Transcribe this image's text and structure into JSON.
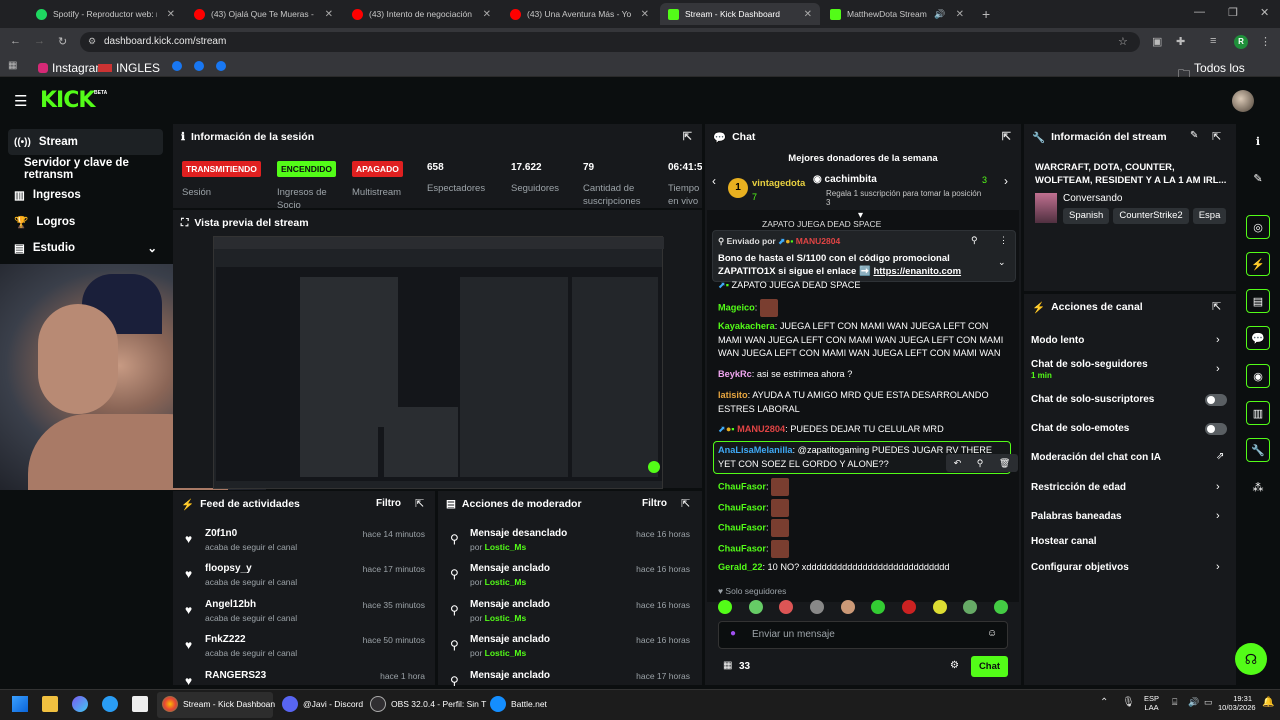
{
  "browser": {
    "tabs": [
      {
        "title": "Spotify - Reproductor web: mús",
        "color": "#1ed760"
      },
      {
        "title": "(43) Ojalá Que Te Mueras - You",
        "color": "#ff0000"
      },
      {
        "title": "(43) Intento de negociación en",
        "color": "#ff0000"
      },
      {
        "title": "(43) Una Aventura Más - YouTu",
        "color": "#ff0000"
      },
      {
        "title": "Stream - Kick Dashboard",
        "color": "#53fc18"
      },
      {
        "title": "MatthewDota Stream - Wa",
        "color": "#53fc18"
      }
    ],
    "url": "dashboard.kick.com/stream",
    "bookmarks": [
      "Instagram",
      "INGLES"
    ],
    "all_bookmarks": "Todos los marcadores",
    "profile_initial": "R"
  },
  "kick": {
    "logo": "KICK",
    "beta": "BETA",
    "sidebar": [
      {
        "label": "Stream",
        "icon": "stream-icon"
      },
      {
        "label": "Servidor y clave de retransm",
        "icon": ""
      },
      {
        "label": "Ingresos",
        "icon": "revenue-icon"
      },
      {
        "label": "Logros",
        "icon": "trophy-icon"
      },
      {
        "label": "Estudio",
        "icon": "studio-icon"
      }
    ],
    "session": {
      "title": "Información de la sesión",
      "badges": [
        {
          "text": "TRANSMITIENDO",
          "label": "Sesión"
        },
        {
          "text": "ENCENDIDO",
          "label": "Ingresos de Socio"
        },
        {
          "text": "APAGADO",
          "label": "Multistream"
        }
      ],
      "stats": [
        {
          "value": "658",
          "label": "Espectadores"
        },
        {
          "value": "17.622",
          "label": "Seguidores"
        },
        {
          "value": "79",
          "label": "Cantidad de suscripciones"
        },
        {
          "value": "06:41:5",
          "label": "Tiempo en vivo"
        }
      ]
    },
    "preview": {
      "title": "Vista previa del stream"
    },
    "feed": {
      "title": "Feed de actividades",
      "filter": "Filtro",
      "items": [
        {
          "name": "Z0f1n0",
          "sub": "acaba de seguir el canal",
          "time": "hace 14 minutos"
        },
        {
          "name": "floopsy_y",
          "sub": "acaba de seguir el canal",
          "time": "hace 17 minutos"
        },
        {
          "name": "Angel12bh",
          "sub": "acaba de seguir el canal",
          "time": "hace 35 minutos"
        },
        {
          "name": "FnkZ222",
          "sub": "acaba de seguir el canal",
          "time": "hace 50 minutos"
        },
        {
          "name": "RANGERS23",
          "sub": "",
          "time": "hace 1 hora"
        }
      ]
    },
    "modactions": {
      "title": "Acciones de moderador",
      "filter": "Filtro",
      "items": [
        {
          "action": "Mensaje desanclado",
          "by": "por",
          "user": "Lostic_Ms",
          "time": "hace 16 horas"
        },
        {
          "action": "Mensaje anclado",
          "by": "por",
          "user": "Lostic_Ms",
          "time": "hace 16 horas"
        },
        {
          "action": "Mensaje anclado",
          "by": "por",
          "user": "Lostic_Ms",
          "time": "hace 16 horas"
        },
        {
          "action": "Mensaje anclado",
          "by": "por",
          "user": "Lostic_Ms",
          "time": "hace 16 horas"
        },
        {
          "action": "Mensaje anclado",
          "by": "",
          "user": "",
          "time": "hace 17 horas"
        }
      ]
    },
    "chat": {
      "title": "Chat",
      "donors_title": "Mejores donadores de la semana",
      "donor1": {
        "name": "vintagedota",
        "rank": "1",
        "count": "7"
      },
      "donor2": {
        "name": "cachimbita",
        "count": "3",
        "promo": "Regala 1 suscripción para tomar la posición",
        "promo_count": "3"
      },
      "top_cut": "ZAPATO JUEGA DEAD SPACE",
      "pinned_by_label": "Enviado por",
      "pinned_by_user": "MANU2804",
      "pinned_text": "Bono de hasta el S/1100 con el código promocional ZAPATITO1X si sigue el enlace ➡️",
      "pinned_link": "https://enanito.com",
      "messages": [
        {
          "user": "",
          "text": "ZAPATO JUEGA DEAD SPACE",
          "ucolor": "#e04444"
        },
        {
          "user": "Mageico",
          "text": "",
          "ucolor": "#53fc18"
        },
        {
          "user": "Kayakachera",
          "text": "JUEGA LEFT CON MAMI WAN JUEGA LEFT CON MAMI WAN JUEGA LEFT CON MAMI WAN JUEGA LEFT CON MAMI WAN JUEGA LEFT CON MAMI WAN JUEGA LEFT CON MAMI WAN",
          "ucolor": "#53fc18"
        },
        {
          "user": "BeykRc",
          "text": "asi se estrimea ahora ?",
          "ucolor": "#f0a5f0"
        },
        {
          "user": "latisito",
          "text": "AYUDA A TU AMIGO MRD QUE ESTA DESARROLANDO ESTRES LABORAL",
          "ucolor": "#e8a640"
        },
        {
          "user": "MANU2804",
          "text": "PUEDES DEJAR TU CELULAR MRD",
          "ucolor": "#e04444"
        },
        {
          "user": "AnaLisaMelanilla",
          "text": "@zapatitogaming PUEDES JUGAR RV THERE YET CON SOEZ EL GORDO Y ALONE??",
          "ucolor": "#3fa9f5"
        },
        {
          "user": "ChauFasor",
          "text": "",
          "ucolor": "#53fc18"
        },
        {
          "user": "ChauFasor",
          "text": "",
          "ucolor": "#53fc18"
        },
        {
          "user": "ChauFasor",
          "text": "",
          "ucolor": "#53fc18"
        },
        {
          "user": "ChauFasor",
          "text": "",
          "ucolor": "#53fc18"
        },
        {
          "user": "Gerald_22",
          "text": "10 NO? xdddddddddddddddddddddddddddd",
          "ucolor": "#53fc18"
        }
      ],
      "followers_only": "Solo seguidores",
      "placeholder": "Enviar un mensaje",
      "points": "33",
      "send": "Chat"
    },
    "streaminfo": {
      "title": "Información del stream",
      "stream_title": "WARCRAFT, DOTA, COUNTER, WOLFTEAM, RESIDENT Y A LA 1 AM IRL...",
      "category": "Conversando",
      "tags": [
        "Spanish",
        "CounterStrike2",
        "Espa"
      ]
    },
    "channel_actions": {
      "title": "Acciones de canal",
      "items": [
        {
          "label": "Modo lento",
          "sub": "",
          "control": "chevron"
        },
        {
          "label": "Chat de solo-seguidores",
          "sub": "1 min",
          "control": "chevron"
        },
        {
          "label": "Chat de solo-suscriptores",
          "sub": "",
          "control": "toggle"
        },
        {
          "label": "Chat de solo-emotes",
          "sub": "",
          "control": "toggle"
        },
        {
          "label": "Moderación del chat con IA",
          "sub": "",
          "control": "external"
        },
        {
          "label": "Restricción de edad",
          "sub": "",
          "control": "chevron"
        },
        {
          "label": "Palabras baneadas",
          "sub": "",
          "control": "chevron"
        },
        {
          "label": "Hostear canal",
          "sub": "",
          "control": "none"
        },
        {
          "label": "Configurar objetivos",
          "sub": "",
          "control": "chevron"
        }
      ]
    }
  },
  "taskbar": {
    "apps": [
      {
        "label": "Stream - Kick Dashboan"
      },
      {
        "label": "@Javi - Discord"
      },
      {
        "label": "OBS 32.0.4 - Perfil: Sin T"
      },
      {
        "label": "Battle.net"
      }
    ],
    "lang1": "ESP",
    "lang2": "LAA",
    "time": "19:31",
    "date": "10/03/2026"
  }
}
